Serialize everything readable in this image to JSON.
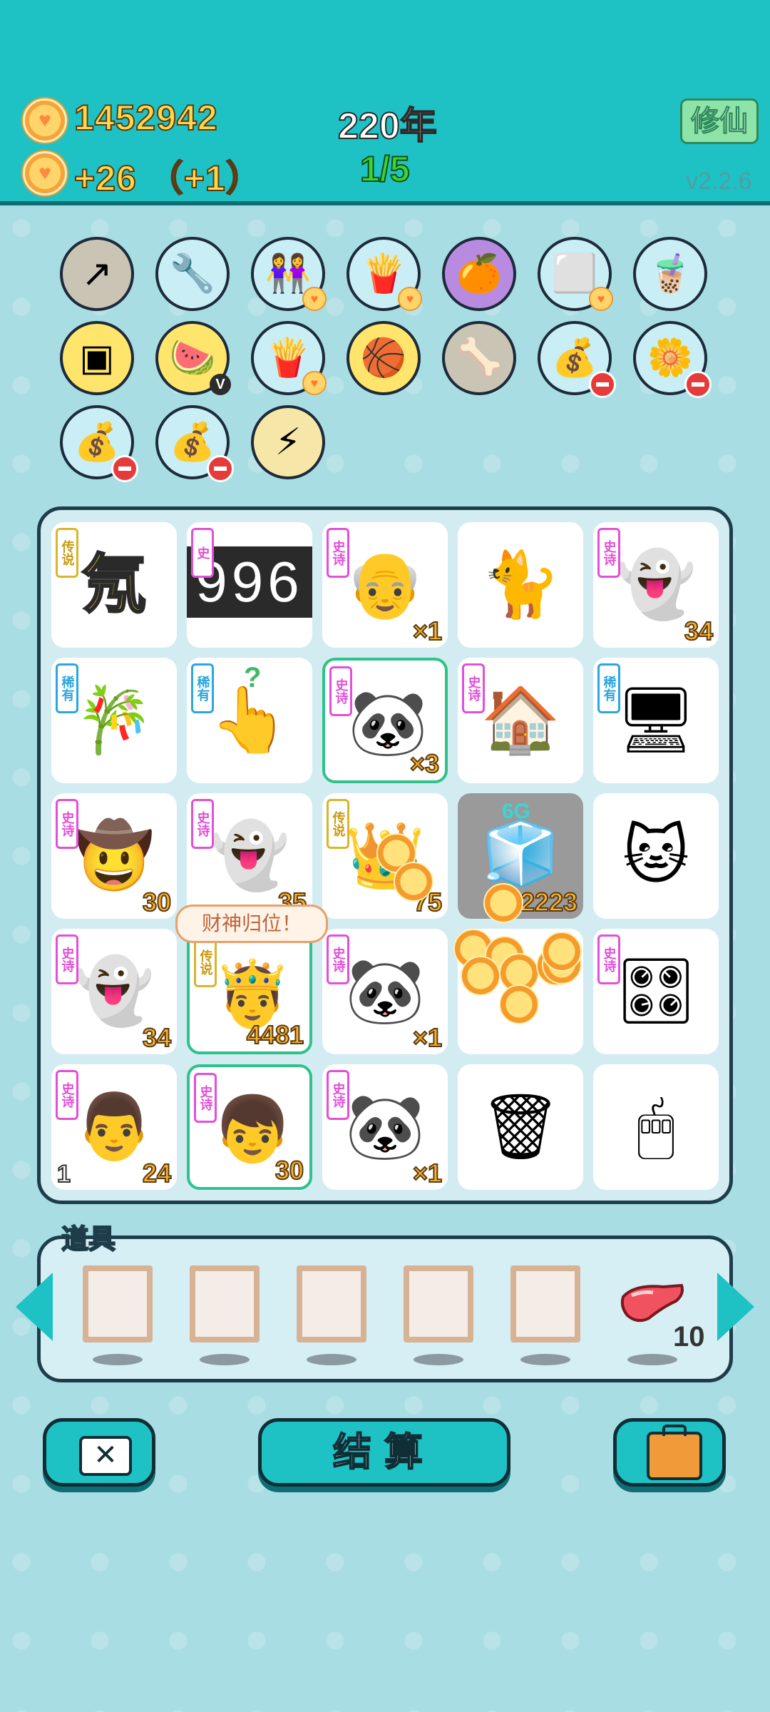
{
  "header": {
    "coins": "1452942",
    "income": "+26 （+1）",
    "year": "220年",
    "stage": "1/5",
    "cultivate_label": "修仙",
    "version": "v2.2.6"
  },
  "relics": [
    {
      "icon": "arrow-card-icon"
    },
    {
      "icon": "shield-wrench-icon"
    },
    {
      "icon": "two-girls-icon"
    },
    {
      "icon": "fries-icon"
    },
    {
      "icon": "eyepatch-orange-icon"
    },
    {
      "icon": "sugar-cubes-icon"
    },
    {
      "icon": "bubble-tea-icon"
    },
    {
      "icon": "cpu-chip-icon"
    },
    {
      "icon": "fruit-basket-icon"
    },
    {
      "icon": "fries-icon"
    },
    {
      "icon": "basketballs-icon"
    },
    {
      "icon": "dog-bowl-icon"
    },
    {
      "icon": "seed-bag-icon"
    },
    {
      "icon": "flower-pot-icon"
    },
    {
      "icon": "seed-bag-icon"
    },
    {
      "icon": "seed-bag-icon"
    },
    {
      "icon": "lightning-icon"
    }
  ],
  "grid": [
    {
      "tag": "传说",
      "icon": "neon-element-icon",
      "glyph": "氖",
      "count": ""
    },
    {
      "tag": "史",
      "icon": "slot-reels-icon",
      "glyph": "996",
      "count": ""
    },
    {
      "tag": "史诗",
      "icon": "old-man-face-icon",
      "glyph": "",
      "count": "×1"
    },
    {
      "tag": "",
      "icon": "yellow-cat-icon",
      "glyph": "",
      "count": ""
    },
    {
      "tag": "史诗",
      "icon": "ghost-icon",
      "glyph": "",
      "count": "34"
    },
    {
      "tag": "稀有",
      "icon": "bamboo-icon",
      "glyph": "",
      "count": ""
    },
    {
      "tag": "稀有",
      "icon": "pointing-hand-icon",
      "glyph": "?",
      "count": ""
    },
    {
      "tag": "史诗",
      "icon": "panda-icon",
      "glyph": "",
      "count": "×3"
    },
    {
      "tag": "史诗",
      "icon": "rabbit-house-icon",
      "glyph": "",
      "count": ""
    },
    {
      "tag": "稀有",
      "icon": "pc-tower-icon",
      "glyph": "",
      "count": ""
    },
    {
      "tag": "史诗",
      "icon": "cowboy-man-icon",
      "glyph": "",
      "count": "30"
    },
    {
      "tag": "史诗",
      "icon": "ghost-icon",
      "glyph": "",
      "count": "35"
    },
    {
      "tag": "传说",
      "icon": "crowned-cat-icon",
      "glyph": "",
      "count": "75"
    },
    {
      "tag": "",
      "icon": "fridge-6g-icon",
      "glyph": "6G",
      "count": "2223"
    },
    {
      "tag": "",
      "icon": "calico-cat-icon",
      "glyph": "",
      "count": ""
    },
    {
      "tag": "史诗",
      "icon": "ghost-icon",
      "glyph": "",
      "count": "34"
    },
    {
      "tag": "传说",
      "icon": "god-of-wealth-icon",
      "glyph": "",
      "count": "4481"
    },
    {
      "tag": "史诗",
      "icon": "panda-icon",
      "glyph": "",
      "count": "×1"
    },
    {
      "tag": "",
      "icon": "coin-burst-icon",
      "glyph": "",
      "count": ""
    },
    {
      "tag": "史诗",
      "icon": "gpu-card-icon",
      "glyph": "",
      "count": ""
    },
    {
      "tag": "史诗",
      "icon": "grandpa-icon",
      "glyph": "",
      "count": "24",
      "count_left": "1"
    },
    {
      "tag": "史诗",
      "icon": "red-hair-boy-icon",
      "glyph": "",
      "count": "30"
    },
    {
      "tag": "史诗",
      "icon": "panda-icon",
      "glyph": "",
      "count": "×1"
    },
    {
      "tag": "",
      "icon": "trash-bag-icon",
      "glyph": "",
      "count": ""
    },
    {
      "tag": "",
      "icon": "mouse-icon",
      "glyph": "",
      "count": ""
    }
  ],
  "bubble_text": "财神归位！",
  "items": {
    "label": "道具",
    "last_item_icon": "liver-icon",
    "last_item_count": "10"
  },
  "buttons": {
    "settle_label": "结算"
  },
  "colors": {
    "header": "#1fc2c4",
    "background": "#a9dde4",
    "coin_text": "#ffd84a",
    "stage_text": "#39d43a"
  }
}
